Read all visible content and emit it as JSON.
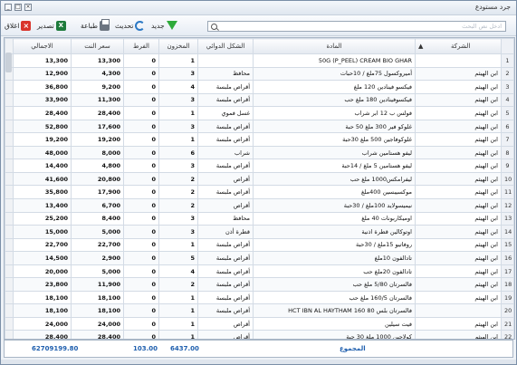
{
  "window": {
    "title": "جرد مستودع"
  },
  "toolbar": {
    "close_label": "اغلاق",
    "export_label": "تصدير",
    "print_label": "طباعة",
    "refresh_label": "تحديث",
    "new_label": "جديد"
  },
  "search": {
    "placeholder": "ادخل نص البحث"
  },
  "table": {
    "headers": {
      "company": "الشركة",
      "material": "المادة",
      "form": "الشكل الدوائي",
      "stock": "المخزون",
      "bonus": "الفرط",
      "price": "سعر النت",
      "total": "الاجمالي"
    },
    "rows": [
      {
        "i": "1",
        "company": "",
        "material": "50G (P_PEEL) CREAM BIO GHAR",
        "form": "",
        "stock": "1",
        "bonus": "0",
        "price": "13,300",
        "total": "13,300"
      },
      {
        "i": "2",
        "company": "ابن الهيثم",
        "material": "أميروكسول 75ملغ / 10حبات",
        "form": "محافظ",
        "stock": "3",
        "bonus": "0",
        "price": "4,300",
        "total": "12,900"
      },
      {
        "i": "3",
        "company": "ابن الهيثم",
        "material": "فيكسو فينادين 120 ملغ",
        "form": "أقراص ملبسة",
        "stock": "4",
        "bonus": "0",
        "price": "9,200",
        "total": "36,800"
      },
      {
        "i": "4",
        "company": "ابن الهيثم",
        "material": "فيكسوفينادين 180 ملغ حب",
        "form": "أقراص ملبسة",
        "stock": "3",
        "bonus": "0",
        "price": "11,300",
        "total": "33,900"
      },
      {
        "i": "5",
        "company": "ابن الهيثم",
        "material": "فولس ب 12 ابر شراب",
        "form": "غسل فموي",
        "stock": "1",
        "bonus": "0",
        "price": "28,400",
        "total": "28,400"
      },
      {
        "i": "6",
        "company": "ابن الهيثم",
        "material": "غلوكو فير 300 ملغ 50 حبة",
        "form": "أقراص ملبسة",
        "stock": "3",
        "bonus": "0",
        "price": "17,600",
        "total": "52,800"
      },
      {
        "i": "7",
        "company": "ابن الهيثم",
        "material": "غلوكوفاجين 500 ملغ 30حبة",
        "form": "أقراص ملبسة",
        "stock": "1",
        "bonus": "0",
        "price": "19,200",
        "total": "19,200"
      },
      {
        "i": "8",
        "company": "ابن الهيثم",
        "material": "ليفو هستامين شراب",
        "form": "شراب",
        "stock": "6",
        "bonus": "0",
        "price": "8,000",
        "total": "48,000"
      },
      {
        "i": "9",
        "company": "ابن الهيثم",
        "material": "ليفو هستامين 5 ملغ / 14حبة",
        "form": "أقراص ملبسة",
        "stock": "3",
        "bonus": "0",
        "price": "4,800",
        "total": "14,400"
      },
      {
        "i": "10",
        "company": "ابن الهيثم",
        "material": "ليفرامكس1000 ملغ حب",
        "form": "أقراص",
        "stock": "2",
        "bonus": "0",
        "price": "20,800",
        "total": "41,600"
      },
      {
        "i": "11",
        "company": "ابن الهيثم",
        "material": "موكسيبسين 400ملغ",
        "form": "أقراص ملبسة",
        "stock": "2",
        "bonus": "0",
        "price": "17,900",
        "total": "35,800"
      },
      {
        "i": "12",
        "company": "ابن الهيثم",
        "material": "نيميسولايد 100ملغ / 30حبة",
        "form": "أقراص",
        "stock": "2",
        "bonus": "0",
        "price": "6,700",
        "total": "13,400"
      },
      {
        "i": "13",
        "company": "ابن الهيثم",
        "material": "اوميكاربونات 40 ملغ",
        "form": "محافظ",
        "stock": "3",
        "bonus": "0",
        "price": "8,400",
        "total": "25,200"
      },
      {
        "i": "14",
        "company": "ابن الهيثم",
        "material": "اوتوكالين قطرة اذنية",
        "form": "قطرة أذن",
        "stock": "3",
        "bonus": "0",
        "price": "5,000",
        "total": "15,000"
      },
      {
        "i": "15",
        "company": "ابن الهيثم",
        "material": "روفاتيو 15ملغ / 30حبة",
        "form": "أقراص ملبسة",
        "stock": "1",
        "bonus": "0",
        "price": "22,700",
        "total": "22,700"
      },
      {
        "i": "16",
        "company": "ابن الهيثم",
        "material": "تادالفون 10ملغ",
        "form": "أقراص ملبسة",
        "stock": "5",
        "bonus": "0",
        "price": "2,900",
        "total": "14,500"
      },
      {
        "i": "17",
        "company": "ابن الهيثم",
        "material": "تادالفون 20ملغ حب",
        "form": "أقراص ملبسة",
        "stock": "4",
        "bonus": "0",
        "price": "5,000",
        "total": "20,000"
      },
      {
        "i": "18",
        "company": "ابن الهيثم",
        "material": "فالسرتان 5/80 ملغ حب",
        "form": "أقراص ملبسة",
        "stock": "2",
        "bonus": "0",
        "price": "11,900",
        "total": "23,800"
      },
      {
        "i": "19",
        "company": "ابن الهيثم",
        "material": "فالسرتان 160/5 ملغ حب",
        "form": "أقراص ملبسة",
        "stock": "1",
        "bonus": "0",
        "price": "18,100",
        "total": "18,100"
      },
      {
        "i": "20",
        "company": "",
        "material": "HCT IBN AL HAYTHAM 160 فالسرتان بلس 80",
        "form": "أقراص ملبسة",
        "stock": "1",
        "bonus": "0",
        "price": "18,100",
        "total": "18,100"
      },
      {
        "i": "21",
        "company": "ابن الهيثم",
        "material": "فيت سيلين",
        "form": "أقراص",
        "stock": "1",
        "bonus": "0",
        "price": "24,000",
        "total": "24,000"
      },
      {
        "i": "22",
        "company": "ابن الهيثم",
        "material": "كولاجين 1000 ملغ 30 حبة",
        "form": "أقراص",
        "stock": "1",
        "bonus": "0",
        "price": "28,400",
        "total": "28,400"
      }
    ]
  },
  "footer": {
    "total_label": "المجموع",
    "stock_total": "6437.00",
    "bonus_total": "103.00",
    "grand_total": "62709199.80"
  },
  "colors": {
    "accent": "#1f5fae",
    "header_bg": "#e4e9f0"
  }
}
